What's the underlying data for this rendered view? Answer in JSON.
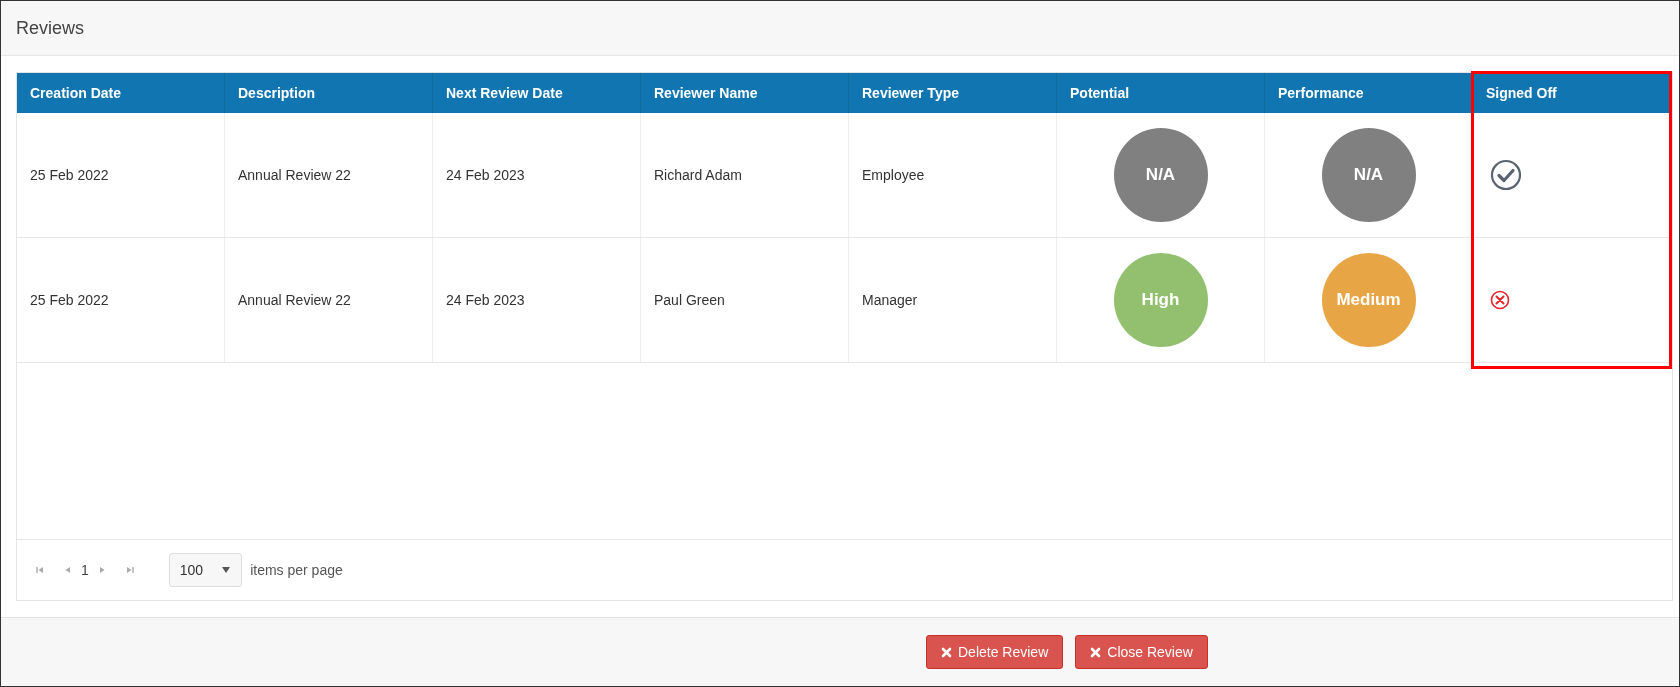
{
  "panel": {
    "title": "Reviews"
  },
  "table": {
    "columns": [
      {
        "label": "Creation Date",
        "highlighted": false
      },
      {
        "label": "Description",
        "highlighted": false
      },
      {
        "label": "Next Review Date",
        "highlighted": false
      },
      {
        "label": "Reviewer Name",
        "highlighted": false
      },
      {
        "label": "Reviewer Type",
        "highlighted": false
      },
      {
        "label": "Potential",
        "highlighted": false
      },
      {
        "label": "Performance",
        "highlighted": false
      },
      {
        "label": "Signed Off",
        "highlighted": true
      }
    ],
    "rows": [
      {
        "creation_date": "25 Feb 2022",
        "description": "Annual Review 22",
        "next_review_date": "24 Feb 2023",
        "reviewer_name": "Richard Adam",
        "reviewer_type": "Employee",
        "potential": {
          "label": "N/A",
          "color": "#808080"
        },
        "performance": {
          "label": "N/A",
          "color": "#808080"
        },
        "signed_off": true
      },
      {
        "creation_date": "25 Feb 2022",
        "description": "Annual Review 22",
        "next_review_date": "24 Feb 2023",
        "reviewer_name": "Paul Green",
        "reviewer_type": "Manager",
        "potential": {
          "label": "High",
          "color": "#92c06e"
        },
        "performance": {
          "label": "Medium",
          "color": "#e8a546"
        },
        "signed_off": false
      }
    ]
  },
  "pager": {
    "page": "1",
    "page_size": "100",
    "page_size_label": "items per page"
  },
  "buttons": [
    {
      "label": "Delete Review"
    },
    {
      "label": "Close Review"
    }
  ]
}
